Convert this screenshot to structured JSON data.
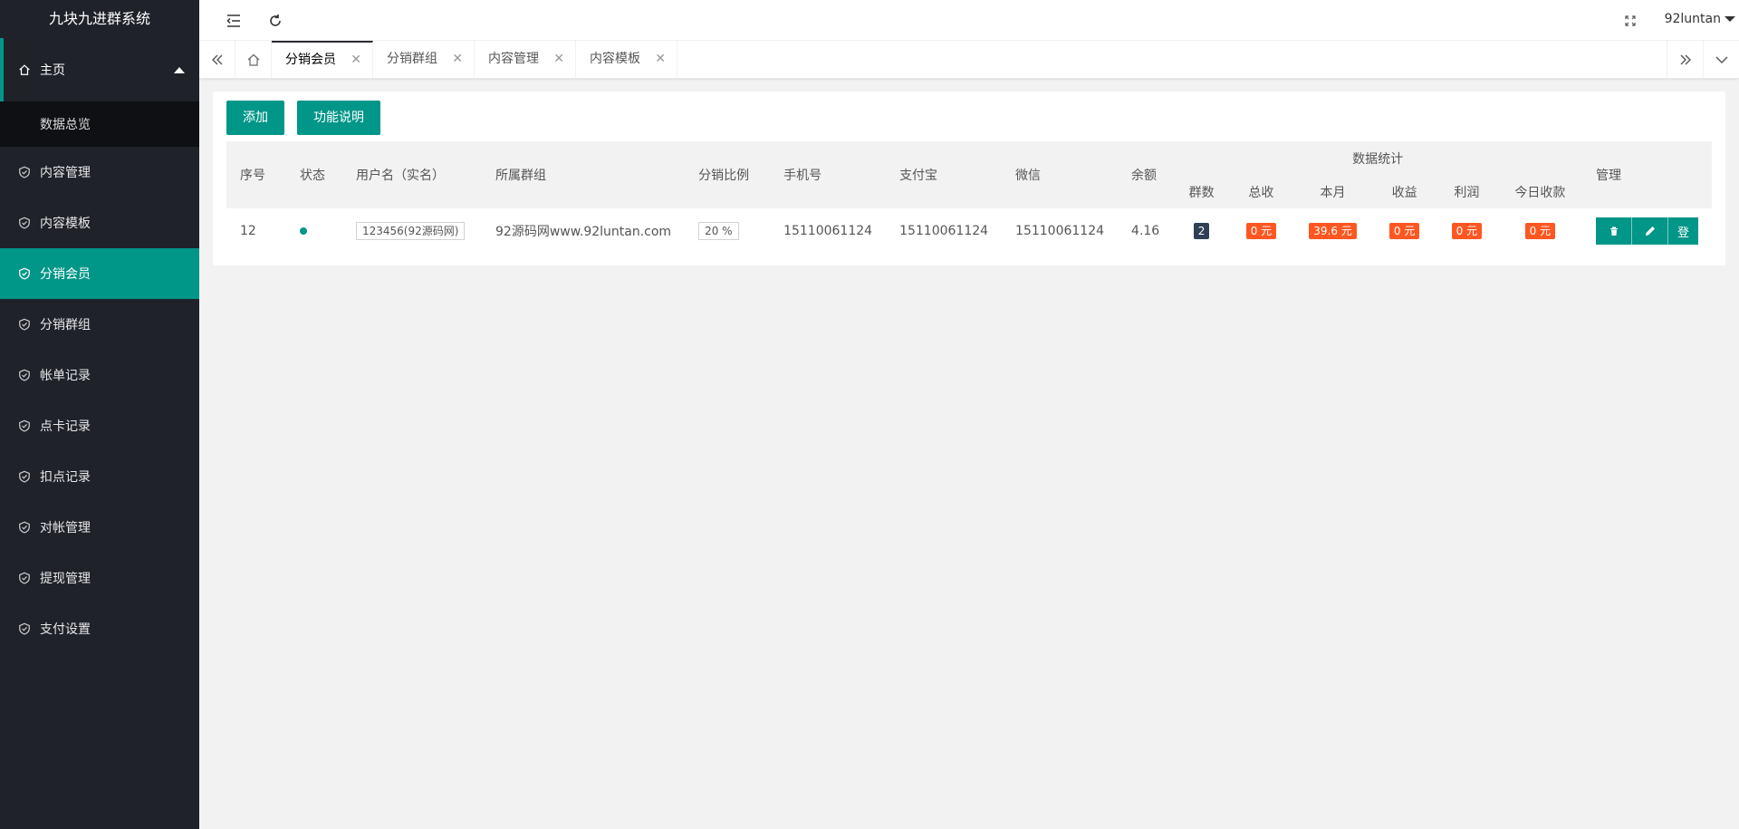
{
  "app": {
    "title": "九块九进群系统"
  },
  "sidebar": {
    "parent": {
      "label": "主页",
      "icon": "home-icon"
    },
    "sub": {
      "label": "数据总览"
    },
    "items": [
      {
        "label": "内容管理",
        "icon": "shield-check-icon",
        "active": false
      },
      {
        "label": "内容模板",
        "icon": "shield-check-icon",
        "active": false
      },
      {
        "label": "分销会员",
        "icon": "shield-check-icon",
        "active": true
      },
      {
        "label": "分销群组",
        "icon": "shield-check-icon",
        "active": false
      },
      {
        "label": "帐单记录",
        "icon": "shield-check-icon",
        "active": false
      },
      {
        "label": "点卡记录",
        "icon": "shield-check-icon",
        "active": false
      },
      {
        "label": "扣点记录",
        "icon": "shield-check-icon",
        "active": false
      },
      {
        "label": "对帐管理",
        "icon": "shield-check-icon",
        "active": false
      },
      {
        "label": "提现管理",
        "icon": "shield-check-icon",
        "active": false
      },
      {
        "label": "支付设置",
        "icon": "shield-check-icon",
        "active": false
      }
    ]
  },
  "header": {
    "user": "92luntan"
  },
  "tabs": [
    {
      "label": "分销会员",
      "active": true
    },
    {
      "label": "分销群组",
      "active": false
    },
    {
      "label": "内容管理",
      "active": false
    },
    {
      "label": "内容模板",
      "active": false
    }
  ],
  "toolbar": {
    "add_label": "添加",
    "help_label": "功能说明"
  },
  "table": {
    "headers": {
      "index": "序号",
      "status": "状态",
      "username": "用户名（实名）",
      "group": "所属群组",
      "ratio": "分销比例",
      "phone": "手机号",
      "alipay": "支付宝",
      "wechat": "微信",
      "balance": "余额",
      "stats": "数据统计",
      "manage": "管理",
      "stats_cols": [
        "群数",
        "总收",
        "本月",
        "收益",
        "利润",
        "今日收款"
      ]
    },
    "rows": [
      {
        "index": "12",
        "status": "active",
        "username": "123456(92源码网)",
        "group": "92源码网www.92luntan.com",
        "ratio": "20 %",
        "phone": "15110061124",
        "alipay": "15110061124",
        "wechat": "15110061124",
        "balance": "4.16",
        "groups": "2",
        "total": "0 元",
        "month": "39.6 元",
        "income": "0 元",
        "profit": "0 元",
        "today": "0 元",
        "login_label": "登"
      }
    ]
  },
  "colors": {
    "accent": "#009688",
    "sidebar_bg": "#20222a",
    "orange": "#ff5722",
    "dark_badge": "#2f4056"
  }
}
